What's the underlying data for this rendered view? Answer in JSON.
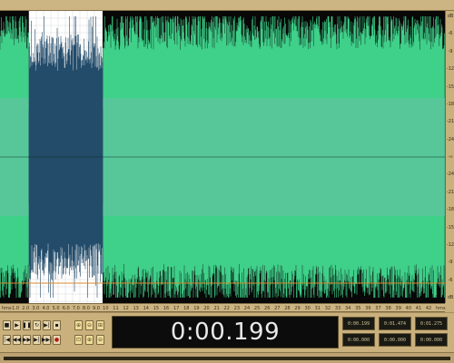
{
  "colors": {
    "background": "#080808",
    "waveform": "#57c79a",
    "waveform_bright": "#3fd08a",
    "selected_background": "#ffffff",
    "selected_waveform": "#234c6b",
    "selection_grid": "#d8d8d8",
    "chrome": "#c9b07c",
    "time_text": "#e8e8e8"
  },
  "waveform": {
    "selection_start_fraction": 0.065,
    "selection_end_fraction": 0.23
  },
  "time_ruler": {
    "labels": [
      "hms",
      "1.0",
      "2.0",
      "3.0",
      "4.0",
      "5.0",
      "6.0",
      "7.0",
      "8.0",
      "9.0",
      "10",
      "11",
      "12",
      "13",
      "14",
      "15",
      "16",
      "17",
      "18",
      "19",
      "20",
      "21",
      "22",
      "23",
      "24",
      "25",
      "26",
      "27",
      "28",
      "29",
      "30",
      "31",
      "32",
      "33",
      "34",
      "35",
      "36",
      "37",
      "38",
      "39",
      "40",
      "41",
      "42",
      "hms"
    ]
  },
  "db_ruler": {
    "labels": [
      "dB",
      "-6",
      "-9",
      "-12",
      "-15",
      "-18",
      "-21",
      "-24",
      "-∞",
      "-24",
      "-21",
      "-18",
      "-15",
      "-12",
      "-9",
      "-6",
      "dB"
    ]
  },
  "transport": {
    "row1": [
      {
        "name": "stop-button",
        "icon": "stop-icon",
        "glyph": "■"
      },
      {
        "name": "play-button",
        "icon": "play-icon",
        "glyph": "▶"
      },
      {
        "name": "pause-button",
        "icon": "pause-icon",
        "glyph": "❚❚"
      },
      {
        "name": "play-looped-button",
        "icon": "loop-icon",
        "glyph": "↻"
      },
      {
        "name": "play-to-end-button",
        "icon": "play-to-end-icon",
        "glyph": "▶|"
      },
      {
        "name": "stop-end-button",
        "icon": "stop-icon",
        "glyph": "▪"
      }
    ],
    "row2": [
      {
        "name": "goto-start-button",
        "icon": "goto-start-icon",
        "glyph": "|◀"
      },
      {
        "name": "rewind-button",
        "icon": "rewind-icon",
        "glyph": "◀◀"
      },
      {
        "name": "fast-forward-button",
        "icon": "fast-forward-icon",
        "glyph": "▶▶"
      },
      {
        "name": "goto-end-button",
        "icon": "goto-end-icon",
        "glyph": "▶|"
      },
      {
        "name": "skip-button",
        "icon": "skip-icon",
        "glyph": "▶▶|"
      },
      {
        "name": "record-button",
        "icon": "record-icon",
        "glyph": "●"
      }
    ],
    "zoom_row1": [
      {
        "name": "zoom-in-horizontal-button",
        "icon": "zoom-in-icon",
        "glyph": "⊕"
      },
      {
        "name": "zoom-out-horizontal-button",
        "icon": "zoom-out-icon",
        "glyph": "⊖"
      },
      {
        "name": "zoom-full-button",
        "icon": "zoom-full-icon",
        "glyph": "⊞"
      }
    ],
    "zoom_row2": [
      {
        "name": "zoom-selection-button",
        "icon": "zoom-selection-icon",
        "glyph": "⊡"
      },
      {
        "name": "zoom-in-vertical-button",
        "icon": "zoom-vertical-icon",
        "glyph": "⊕"
      },
      {
        "name": "zoom-out-vertical-button",
        "icon": "zoom-vertical-out-icon",
        "glyph": "⊖"
      }
    ]
  },
  "time_display": {
    "value": "0:00.199"
  },
  "selection_info": {
    "cells": [
      "0:00.199",
      "0:01.474",
      "0:01.275",
      "0:00.000",
      "0:00.000",
      "0:00.000"
    ]
  }
}
